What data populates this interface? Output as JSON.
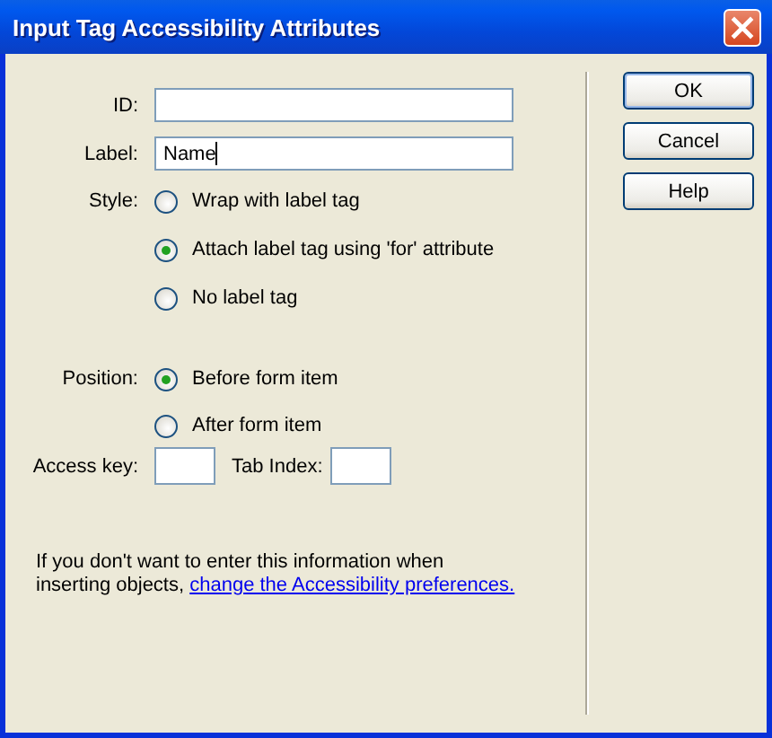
{
  "window": {
    "title": "Input Tag Accessibility Attributes"
  },
  "fields": [
    {
      "label": "ID:",
      "focused": false
    },
    {
      "label": "Label:",
      "value": "Name",
      "focused": true
    }
  ],
  "style": {
    "label": "Style:",
    "options": [
      {
        "label": "Wrap with label tag",
        "selected": false
      },
      {
        "label": "Attach label tag using 'for' attribute",
        "selected": true
      },
      {
        "label": "No label tag",
        "selected": false
      }
    ]
  },
  "position": {
    "label": "Position:",
    "options": [
      {
        "label": "Before form item",
        "selected": true
      },
      {
        "label": "After form item",
        "selected": false
      }
    ]
  },
  "access_key": {
    "label": "Access key:"
  },
  "tab_index": {
    "label": "Tab Index:"
  },
  "note": {
    "text": "If you don't want to enter this information when inserting objects,",
    "link": "change the Accessibility preferences."
  },
  "buttons": [
    "OK",
    "Cancel",
    "Help"
  ]
}
